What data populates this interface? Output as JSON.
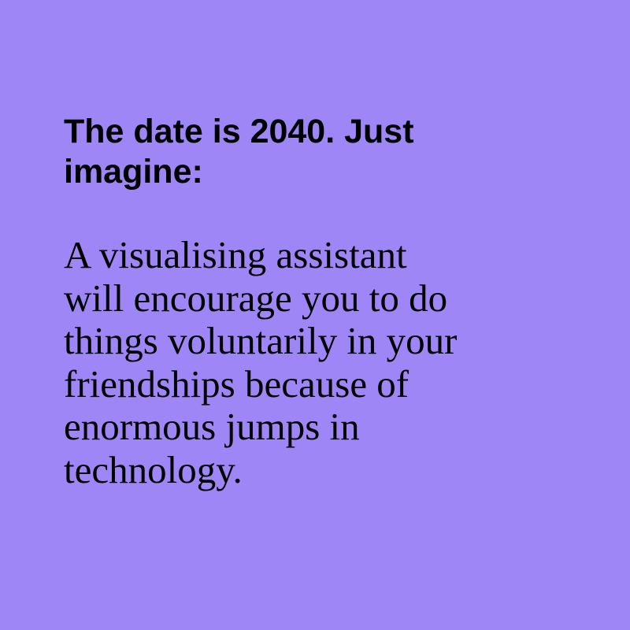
{
  "colors": {
    "background": "#9f86f7",
    "text": "#000000"
  },
  "headline": {
    "lines": [
      "The date is 2040. Just",
      "imagine:"
    ]
  },
  "body": {
    "lines": [
      "A visualising assistant",
      "will encourage you to do",
      "things voluntarily in your",
      "friendships because of",
      "enormous jumps in",
      "technology."
    ]
  }
}
